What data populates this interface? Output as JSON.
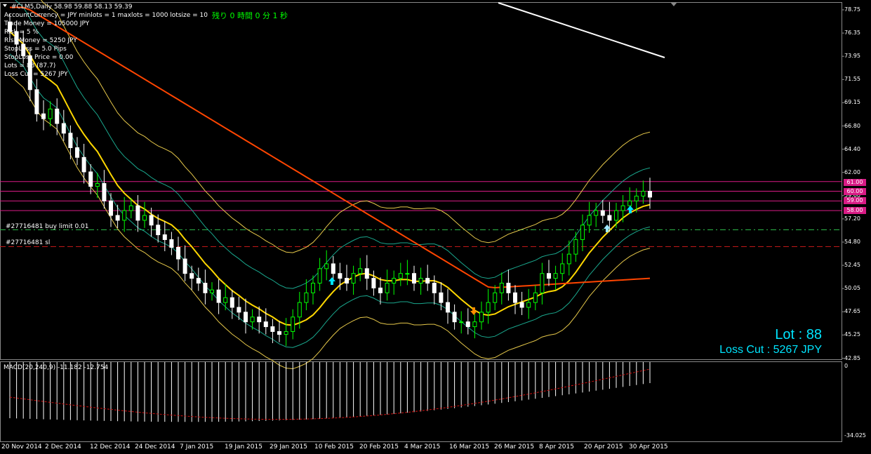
{
  "header": {
    "title": "#CLM5,Daily  58.98 59.88 58.13 59.39",
    "info_lines": [
      "AccountCurrency = JPY  minlots = 1  maxlots = 1000  lotsize = 10",
      "Trade Money = 105000 JPY",
      "Risk = 5 %",
      "Risk Money = 5250 JPY",
      "StopLoss = 5.0 Pips",
      "StopLoss Price = 0.00",
      "Lots = 88  (87.7)",
      "Loss Cut = 5267 JPY"
    ],
    "timer": "残り 0 時間 0 分 1 秒"
  },
  "orders": {
    "buy_limit": "#27716481 buy limit 0.01",
    "sl": "#27716481 sl"
  },
  "big_display": {
    "lot": "Lot : 88",
    "loss_cut": "Loss Cut : 5267 JPY"
  },
  "price_axis": [
    "78.75",
    "76.35",
    "73.95",
    "71.55",
    "69.15",
    "66.80",
    "64.40",
    "62.00",
    "59.60",
    "57.20",
    "54.80",
    "52.45",
    "50.05",
    "47.65",
    "45.25",
    "42.85"
  ],
  "level_tags": [
    "61.00",
    "60.00",
    "59.00",
    "58.00"
  ],
  "macd": {
    "label": "MACD(20,240,9) -11.182 -12.754",
    "axis_top": "0",
    "axis_bottom": "-34.025"
  },
  "date_axis": [
    "20 Nov 2014",
    "2 Dec 2014",
    "12 Dec 2014",
    "24 Dec 2014",
    "7 Jan 2015",
    "19 Jan 2015",
    "29 Jan 2015",
    "10 Feb 2015",
    "20 Feb 2015",
    "4 Mar 2015",
    "16 Mar 2015",
    "26 Mar 2015",
    "8 Apr 2015",
    "20 Apr 2015",
    "30 Apr 2015"
  ],
  "colors": {
    "background": "#000000",
    "bull_candle": "#00ff00",
    "bear_candle": "#ffffff",
    "ma_fast": "#ffd700",
    "ma_slow": "#ff4500",
    "band_outer": "#e6c84a",
    "band_inner": "#1aa88e",
    "level_line": "#d81b85",
    "arrow_up": "#00e5ff",
    "arrow_down": "#ff8c00"
  },
  "chart_data": {
    "type": "candlestick",
    "symbol": "#CLM5",
    "timeframe": "Daily",
    "ohlc_last": {
      "open": 58.98,
      "high": 59.88,
      "low": 58.13,
      "close": 59.39
    },
    "ylim": [
      42.85,
      78.75
    ],
    "closes": [
      76.5,
      75.2,
      74.0,
      70.5,
      68.0,
      67.5,
      68.5,
      67.0,
      66.0,
      64.5,
      63.5,
      62.0,
      60.5,
      60.8,
      59.0,
      57.5,
      57.0,
      58.0,
      58.5,
      57.0,
      57.5,
      56.5,
      55.5,
      55.0,
      54.2,
      53.0,
      51.5,
      51.0,
      50.5,
      49.5,
      49.8,
      48.5,
      49.0,
      48.0,
      47.5,
      46.5,
      47.0,
      46.5,
      46.0,
      45.5,
      45.2,
      45.5,
      47.0,
      48.5,
      49.5,
      50.5,
      52.0,
      52.5,
      51.5,
      51.0,
      50.5,
      51.5,
      52.0,
      51.0,
      50.0,
      49.5,
      50.5,
      51.0,
      51.5,
      51.5,
      50.5,
      51.0,
      50.5,
      49.5,
      48.5,
      47.5,
      46.5,
      46.5,
      46.0,
      46.5,
      47.5,
      48.5,
      49.5,
      50.5,
      49.5,
      48.5,
      48.0,
      48.5,
      49.5,
      51.5,
      51.0,
      51.5,
      52.5,
      53.5,
      55.0,
      56.5,
      57.5,
      58.0,
      57.5,
      57.0,
      58.0,
      58.5,
      59.0,
      59.5,
      60.0,
      59.39
    ]
  }
}
